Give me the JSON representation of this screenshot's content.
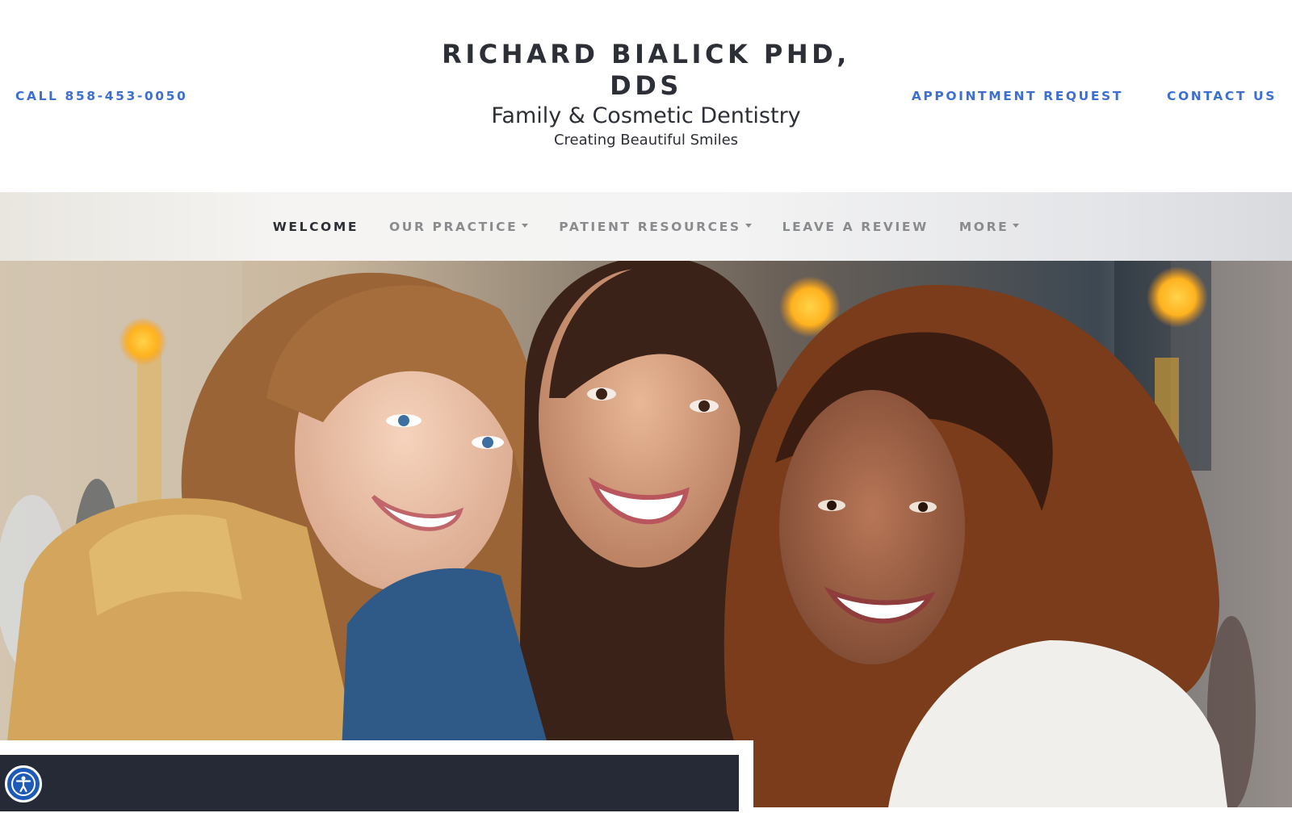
{
  "header": {
    "call_link": "CALL 858-453-0050",
    "brand_name": "RICHARD BIALICK PHD, DDS",
    "brand_subtitle": "Family & Cosmetic Dentistry",
    "brand_tagline": "Creating Beautiful Smiles",
    "appointment_link": "APPOINTMENT REQUEST",
    "contact_link": "CONTACT US"
  },
  "nav": {
    "items": [
      {
        "label": "WELCOME",
        "active": true,
        "has_dropdown": false
      },
      {
        "label": "OUR PRACTICE",
        "active": false,
        "has_dropdown": true
      },
      {
        "label": "PATIENT RESOURCES",
        "active": false,
        "has_dropdown": true
      },
      {
        "label": "LEAVE A REVIEW",
        "active": false,
        "has_dropdown": false
      },
      {
        "label": "MORE",
        "active": false,
        "has_dropdown": true
      }
    ]
  },
  "hero": {
    "image_subject": "three smiling women outdoors"
  },
  "accessibility": {
    "icon": "accessibility-icon"
  },
  "colors": {
    "link_blue": "#3d6fd1",
    "text_dark": "#2d2f36",
    "nav_gray": "#8a8b8e",
    "overlay_navy": "#262a36",
    "access_blue": "#1e5bb8"
  }
}
